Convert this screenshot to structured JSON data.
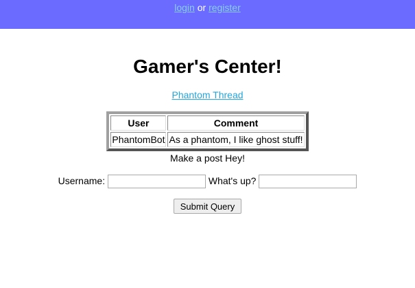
{
  "header": {
    "login_label": "login",
    "or_text": "or",
    "register_label": "register",
    "background_color": "#6b6bff",
    "link_color": "#87cef0"
  },
  "main": {
    "title": "Gamer's Center!",
    "thread_link": "Phantom Thread",
    "table": {
      "headers": [
        "User",
        "Comment"
      ],
      "rows": [
        [
          "PhantomBot",
          "As a phantom, I like ghost stuff!"
        ]
      ]
    },
    "make_post_text": "Make a post Hey!",
    "form": {
      "username_label": "Username:",
      "username_value": "",
      "whatsup_label": "What's up?",
      "whatsup_value": "",
      "submit_label": "Submit Query"
    }
  }
}
